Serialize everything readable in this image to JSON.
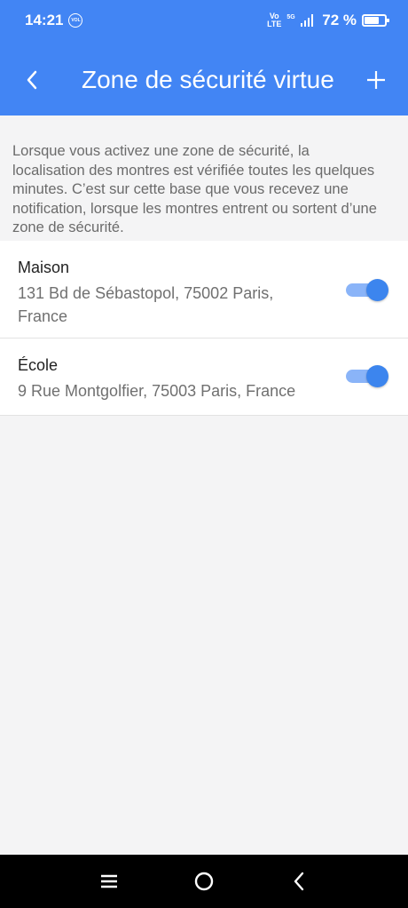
{
  "status_bar": {
    "time": "14:21",
    "notif_icon_text": "VOL",
    "network_top": "Vo",
    "network_bottom": "LTE",
    "network_gen": "5G",
    "battery": "72 %",
    "battery_level": 0.72
  },
  "toolbar": {
    "title": "Zone de sécurité virtue",
    "back_icon": "chevron-left-icon",
    "add_icon": "plus-icon"
  },
  "info_text": {
    "line1": "Lorsque vous activez une zone de sécurité, la",
    "line2": "localisation des montres est vérifiée toutes les quelques",
    "line3": "minutes. C’est sur cette base que vous recevez une",
    "line4": "notification, lorsque les montres entrent ou sortent d’une",
    "line5": "zone de sécurité."
  },
  "zones": [
    {
      "name": "Maison",
      "address": "131 Bd de Sébastopol, 75002 Paris, France",
      "enabled": true
    },
    {
      "name": "École",
      "address": "9 Rue Montgolfier, 75003 Paris, France",
      "enabled": true
    }
  ],
  "colors": {
    "header": "#4285f4",
    "toggle_on": "#3c85ee",
    "background": "#f4f4f5"
  },
  "nav_bar": {
    "icons": [
      "menu-icon",
      "home-circle-icon",
      "back-triangle-icon"
    ]
  }
}
